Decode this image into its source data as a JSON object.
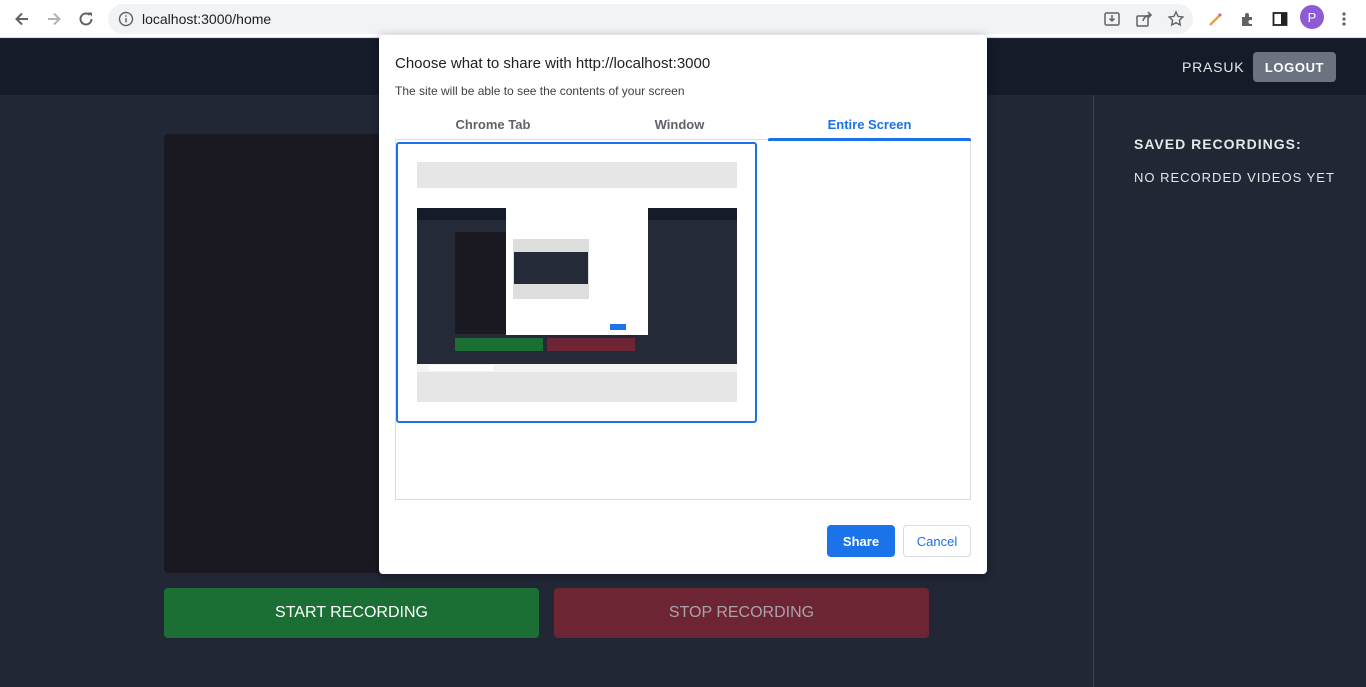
{
  "browser": {
    "url": "localhost:3000/home",
    "avatar_letter": "P"
  },
  "app": {
    "user_name": "PRASUK",
    "logout_label": "LOGOUT",
    "start_label": "START RECORDING",
    "stop_label": "STOP RECORDING",
    "saved_title": "SAVED RECORDINGS:",
    "saved_empty": "NO RECORDED VIDEOS YET"
  },
  "dialog": {
    "title": "Choose what to share with http://localhost:3000",
    "subtitle": "The site will be able to see the contents of your screen",
    "tabs": [
      {
        "label": "Chrome Tab",
        "active": false
      },
      {
        "label": "Window",
        "active": false
      },
      {
        "label": "Entire Screen",
        "active": true
      }
    ],
    "share_label": "Share",
    "cancel_label": "Cancel"
  },
  "colors": {
    "accent": "#1a73e8",
    "start_button": "#1b6f34",
    "stop_button": "#6e2533",
    "page_bg": "#222735"
  }
}
